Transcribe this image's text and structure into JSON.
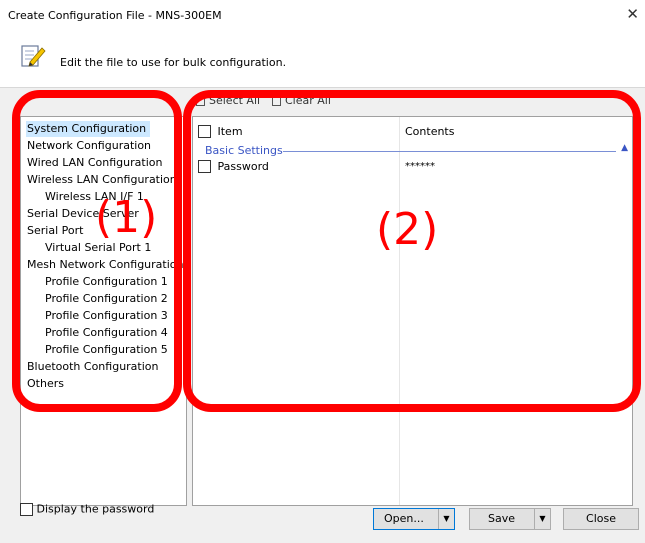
{
  "window": {
    "title": "Create Configuration File - MNS-300EM",
    "close_glyph": "✕"
  },
  "header": {
    "icon": "edit-document-icon",
    "text": "Edit the file to use for bulk configuration."
  },
  "toolbar": {
    "select_all": "Select All",
    "clear_all": "Clear All"
  },
  "tree": {
    "items": [
      {
        "label": "System Configuration",
        "selected": true,
        "indent": 0
      },
      {
        "label": "Network Configuration",
        "indent": 0
      },
      {
        "label": "Wired LAN Configuration",
        "indent": 0
      },
      {
        "label": "Wireless LAN Configuration",
        "indent": 0
      },
      {
        "label": "Wireless LAN I/F 1",
        "indent": 1
      },
      {
        "label": "Serial Device Server",
        "indent": 0
      },
      {
        "label": "Serial Port",
        "indent": 0
      },
      {
        "label": "Virtual Serial Port 1",
        "indent": 1
      },
      {
        "label": "Mesh Network Configuration",
        "indent": 0
      },
      {
        "label": "Profile Configuration 1",
        "indent": 1
      },
      {
        "label": "Profile Configuration 2",
        "indent": 1
      },
      {
        "label": "Profile Configuration 3",
        "indent": 1
      },
      {
        "label": "Profile Configuration 4",
        "indent": 1
      },
      {
        "label": "Profile Configuration 5",
        "indent": 1
      },
      {
        "label": "Bluetooth Configuration",
        "indent": 0
      },
      {
        "label": "Others",
        "indent": 0
      }
    ]
  },
  "grid": {
    "col_item": "Item",
    "col_contents": "Contents",
    "group": "Basic Settings",
    "group_caret": "▲",
    "rows": [
      {
        "item": "Password",
        "contents": "******"
      }
    ]
  },
  "annotations": {
    "label_1": "(1)",
    "label_2": "(2)",
    "color": "#ff0000"
  },
  "footer": {
    "display_password": "Display the password",
    "open": "Open...",
    "save": "Save",
    "close": "Close",
    "dropdown_glyph": "▼"
  }
}
